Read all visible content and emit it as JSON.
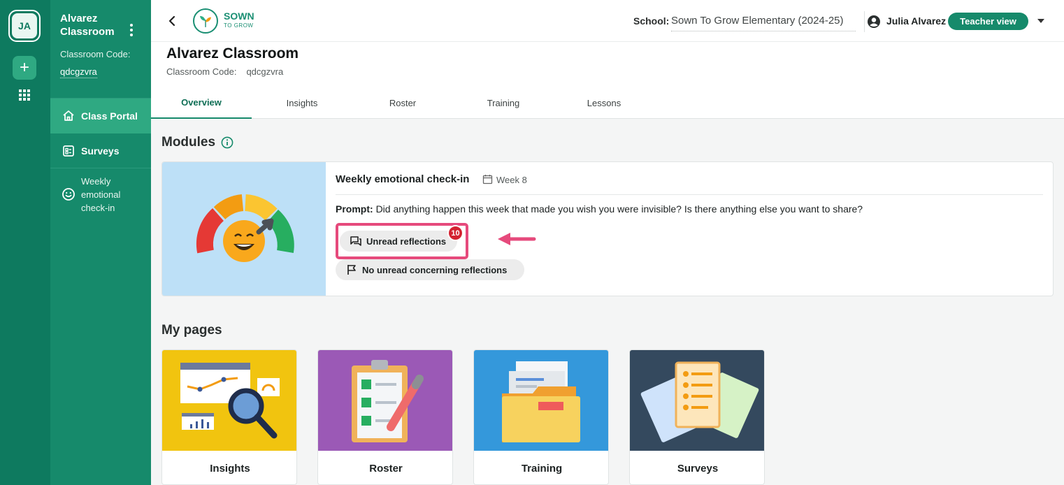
{
  "rail": {
    "avatar_initials": "JA",
    "add_label": "+"
  },
  "sidebar": {
    "class_title": "Alvarez Classroom",
    "code_label": "Classroom Code:",
    "code_value": "qdcgzvra",
    "items": [
      {
        "label": "Class Portal",
        "icon": "home-icon",
        "active": true
      },
      {
        "label": "Surveys",
        "icon": "survey-icon",
        "active": false
      },
      {
        "label": "Weekly emotional check-in",
        "icon": "smiley-icon",
        "active": false
      }
    ]
  },
  "topbar": {
    "logo_main": "SOWN",
    "logo_sub": "TO GROW",
    "school_label": "School:",
    "school_value": "Sown To Grow Elementary (2024-25)",
    "user_name": "Julia Alvarez",
    "view_badge": "Teacher view"
  },
  "header": {
    "title": "Alvarez Classroom",
    "code_label": "Classroom Code:",
    "code_value": "qdcgzvra"
  },
  "tabs": [
    {
      "label": "Overview",
      "active": true
    },
    {
      "label": "Insights",
      "active": false
    },
    {
      "label": "Roster",
      "active": false
    },
    {
      "label": "Training",
      "active": false
    },
    {
      "label": "Lessons",
      "active": false
    }
  ],
  "modules": {
    "heading": "Modules",
    "card": {
      "title": "Weekly emotional check-in",
      "week": "Week 8",
      "prompt_label": "Prompt:",
      "prompt_text": "Did anything happen this week that made you wish you were invisible? Is there anything else you want to share?",
      "unread_label": "Unread reflections",
      "unread_count": "10",
      "concerning_label": "No unread concerning reflections"
    }
  },
  "my_pages": {
    "heading": "My pages",
    "cards": [
      {
        "label": "Insights",
        "color": "#f1c40f"
      },
      {
        "label": "Roster",
        "color": "#9b59b6"
      },
      {
        "label": "Training",
        "color": "#3498db"
      },
      {
        "label": "Surveys",
        "color": "#34495e"
      }
    ]
  },
  "colors": {
    "brand": "#168a6b",
    "rail": "#0e7a5f",
    "accent_pink": "#e64a7c",
    "badge_red": "#d32231"
  }
}
